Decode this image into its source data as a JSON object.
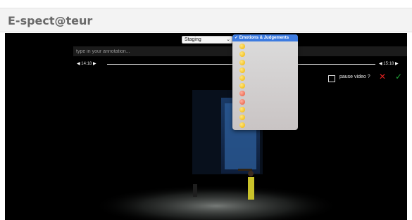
{
  "app": {
    "title": "E-spect@teur"
  },
  "toolbar": {
    "select_value": "Staging"
  },
  "annotation": {
    "placeholder": "type in your annotation..."
  },
  "timeline": {
    "start": "14:18",
    "end": "15:18"
  },
  "pause": {
    "label": "pause video ?"
  },
  "dropdown": {
    "header": "✓ Emotions & Judgements",
    "items": [
      {
        "icon": "smiling-face-emoji"
      },
      {
        "icon": "grinning-face-emoji"
      },
      {
        "icon": "laughing-face-emoji"
      },
      {
        "icon": "neutral-face-emoji"
      },
      {
        "icon": "frowning-face-emoji"
      },
      {
        "icon": "sad-face-emoji"
      },
      {
        "icon": "heart-eyes-emoji"
      },
      {
        "icon": "heart-eyes-emoji"
      },
      {
        "icon": "surprised-face-emoji"
      },
      {
        "icon": "confused-face-emoji"
      },
      {
        "icon": "thumbs-up-emoji"
      }
    ]
  },
  "colors": {
    "cancel": "#e02020",
    "confirm": "#22a83a",
    "dropdown_header": "#3d7be0"
  }
}
